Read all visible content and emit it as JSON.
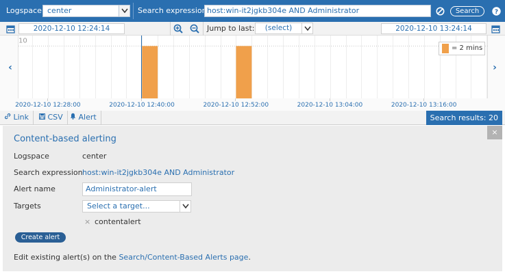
{
  "topbar": {
    "logspace_label": "Logspace",
    "logspace_value": "center",
    "search_expression_label": "Search expression",
    "search_expression_value": "host:win-it2jgkb304e AND Administrator",
    "search_button": "Search",
    "clear_icon": "clear-icon",
    "help_icon": "help-icon",
    "accent": "#2a6fb0"
  },
  "timerow": {
    "start_time": "2020-12-10 12:24:14",
    "end_time": "2020-12-10 13:24:14",
    "jump_label": "Jump to last:",
    "jump_value": "(select)"
  },
  "chart_data": {
    "type": "bar",
    "x_tick_labels": [
      "2020-12-10 12:28:00",
      "2020-12-10 12:40:00",
      "2020-12-10 12:52:00",
      "2020-12-10 13:04:00",
      "2020-12-10 13:16:00"
    ],
    "x_range": [
      "2020-12-10 12:24:14",
      "2020-12-10 13:24:14"
    ],
    "y_tick_label": "10",
    "bars": [
      {
        "start": "2020-12-10 12:40:00",
        "end": "2020-12-10 12:42:00",
        "value": 10
      },
      {
        "start": "2020-12-10 12:52:00",
        "end": "2020-12-10 12:54:00",
        "value": 10
      }
    ],
    "ylim": [
      0,
      12
    ],
    "legend": "= 2 mins",
    "legend_position": "top-right",
    "bar_color": "#f0a04b",
    "marker_time": "2020-12-10 12:40:00",
    "marker_color": "#2a6fb0"
  },
  "tabs": {
    "link": "Link",
    "csv": "CSV",
    "alert": "Alert",
    "results": "Search results: 20"
  },
  "panel": {
    "title": "Content-based alerting",
    "close_label": "×",
    "logspace_label": "Logspace",
    "logspace_value": "center",
    "search_label": "Search expression",
    "search_value": "host:win-it2jgkb304e AND Administrator",
    "alert_name_label": "Alert name",
    "alert_name_value": "Administrator-alert",
    "targets_label": "Targets",
    "targets_placeholder": "Select a target...",
    "target_item": "contentalert",
    "target_remove": "×",
    "create_button": "Create alert",
    "footer_prefix": "Edit existing alert(s) on the ",
    "footer_link": "Search/Content-Based Alerts page",
    "footer_suffix": "."
  }
}
